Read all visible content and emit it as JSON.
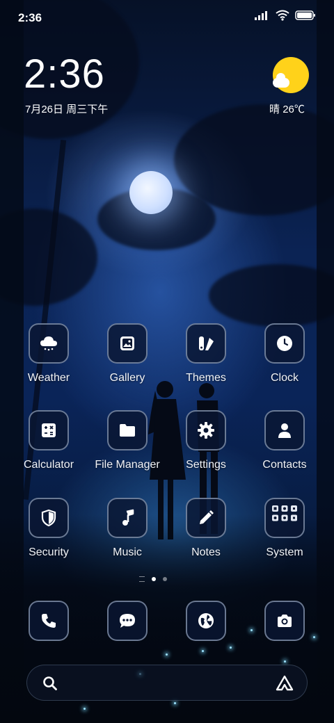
{
  "status_bar": {
    "time": "2:36"
  },
  "clock_widget": {
    "time": "2:36",
    "date": "7月26日 周三下午"
  },
  "weather_widget": {
    "condition": "晴",
    "temperature": "26℃"
  },
  "apps": [
    {
      "label": "Weather",
      "icon": "weather-cloud-icon"
    },
    {
      "label": "Gallery",
      "icon": "image-icon"
    },
    {
      "label": "Themes",
      "icon": "themes-icon"
    },
    {
      "label": "Clock",
      "icon": "clock-icon"
    },
    {
      "label": "Calculator",
      "icon": "calculator-icon"
    },
    {
      "label": "File Manager",
      "icon": "folder-icon"
    },
    {
      "label": "Settings",
      "icon": "gear-icon"
    },
    {
      "label": "Contacts",
      "icon": "person-icon"
    },
    {
      "label": "Security",
      "icon": "shield-icon"
    },
    {
      "label": "Music",
      "icon": "music-note-icon"
    },
    {
      "label": "Notes",
      "icon": "pencil-icon"
    },
    {
      "label": "System",
      "icon": "folder-grid-icon"
    }
  ],
  "page_indicator": {
    "pages": 2,
    "current": 1
  },
  "dock": [
    {
      "icon": "phone-icon"
    },
    {
      "icon": "message-icon"
    },
    {
      "icon": "browser-globe-icon"
    },
    {
      "icon": "camera-icon"
    }
  ],
  "colors": {
    "sun": "#ffd21a",
    "icon_bg": "#0a1632",
    "icon_border": "#a0afc8"
  }
}
